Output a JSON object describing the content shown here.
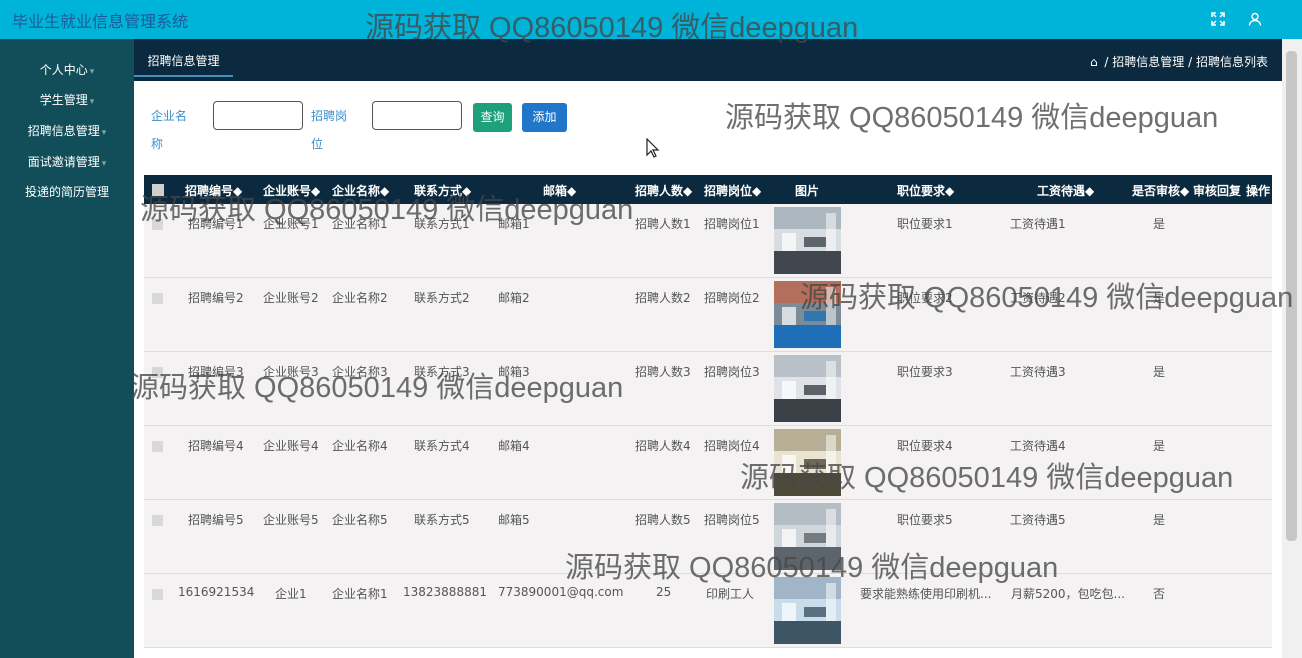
{
  "app": {
    "title": "毕业生就业信息管理系统"
  },
  "topbar": {
    "fullscreen_icon": "expand-icon",
    "user_icon": "user-icon"
  },
  "sidebar": {
    "items": [
      {
        "label": "个人中心",
        "has_caret": true
      },
      {
        "label": "学生管理",
        "has_caret": true
      },
      {
        "label": "招聘信息管理",
        "has_caret": true
      },
      {
        "label": "面试邀请管理",
        "has_caret": true
      },
      {
        "label": "投递的简历管理",
        "has_caret": false
      }
    ]
  },
  "subbar": {
    "tab": "招聘信息管理",
    "breadcrumb": {
      "sep": "/",
      "parent": "招聘信息管理",
      "current": "招聘信息列表"
    }
  },
  "search": {
    "company_label": "企业名称",
    "company_value": "",
    "job_label": "招聘岗位",
    "job_value": "",
    "query_button": "查询",
    "add_button": "添加"
  },
  "table": {
    "headers": [
      "招聘编号",
      "企业账号",
      "企业名称",
      "联系方式",
      "邮箱",
      "招聘人数",
      "招聘岗位",
      "图片",
      "职位要求",
      "工资待遇",
      "是否审核",
      "审核回复",
      "操作"
    ],
    "sortable": [
      true,
      true,
      true,
      true,
      true,
      true,
      true,
      false,
      true,
      true,
      true,
      false,
      false
    ],
    "rows": [
      [
        "招聘编号1",
        "企业账号1",
        "企业名称1",
        "联系方式1",
        "邮箱1",
        "招聘人数1",
        "招聘岗位1",
        "职位要求1",
        "工资待遇1",
        "是"
      ],
      [
        "招聘编号2",
        "企业账号2",
        "企业名称2",
        "联系方式2",
        "邮箱2",
        "招聘人数2",
        "招聘岗位2",
        "职位要求2",
        "工资待遇2",
        "是"
      ],
      [
        "招聘编号3",
        "企业账号3",
        "企业名称3",
        "联系方式3",
        "邮箱3",
        "招聘人数3",
        "招聘岗位3",
        "职位要求3",
        "工资待遇3",
        "是"
      ],
      [
        "招聘编号4",
        "企业账号4",
        "企业名称4",
        "联系方式4",
        "邮箱4",
        "招聘人数4",
        "招聘岗位4",
        "职位要求4",
        "工资待遇4",
        "是"
      ],
      [
        "招聘编号5",
        "企业账号5",
        "企业名称5",
        "联系方式5",
        "邮箱5",
        "招聘人数5",
        "招聘岗位5",
        "职位要求5",
        "工资待遇5",
        "是"
      ],
      [
        "1616921534",
        "企业1",
        "企业名称1",
        "13823888881",
        "773890001@qq.com",
        "25",
        "印刷工人",
        "要求能熟练使用印刷机...",
        "月薪5200，包吃包...",
        "否"
      ]
    ]
  },
  "watermark": {
    "text": "源码获取 QQ86050149 微信deepguan"
  },
  "colors": {
    "topbar": "#00b3d9",
    "sidebar": "#114e5a",
    "header": "#0b2a3f",
    "query": "#1da07b",
    "add": "#2176c9"
  }
}
